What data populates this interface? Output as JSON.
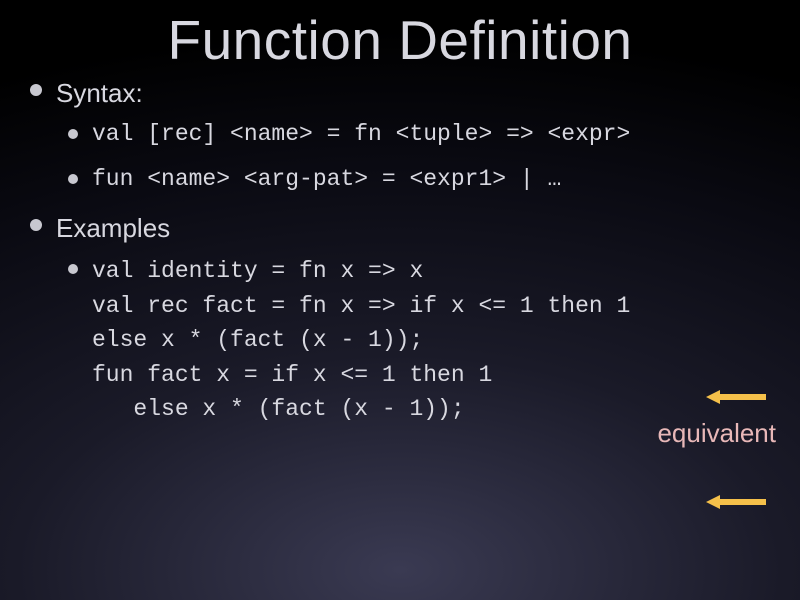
{
  "title": "Function Definition",
  "sections": [
    {
      "heading": "Syntax:",
      "items": [
        "val [rec] <name> = fn <tuple> => <expr>",
        "fun <name> <arg-pat> = <expr1> | …"
      ]
    },
    {
      "heading": "Examples",
      "items": [
        "val identity = fn x => x\nval rec fact = fn x => if x <= 1 then 1\nelse x * (fact (x - 1));\nfun fact x = if x <= 1 then 1\n   else x * (fact (x - 1));"
      ]
    }
  ],
  "annotation": "equivalent",
  "colors": {
    "text": "#d8d8e0",
    "annotation": "#e8b8b8",
    "arrow": "#f5c04a"
  }
}
